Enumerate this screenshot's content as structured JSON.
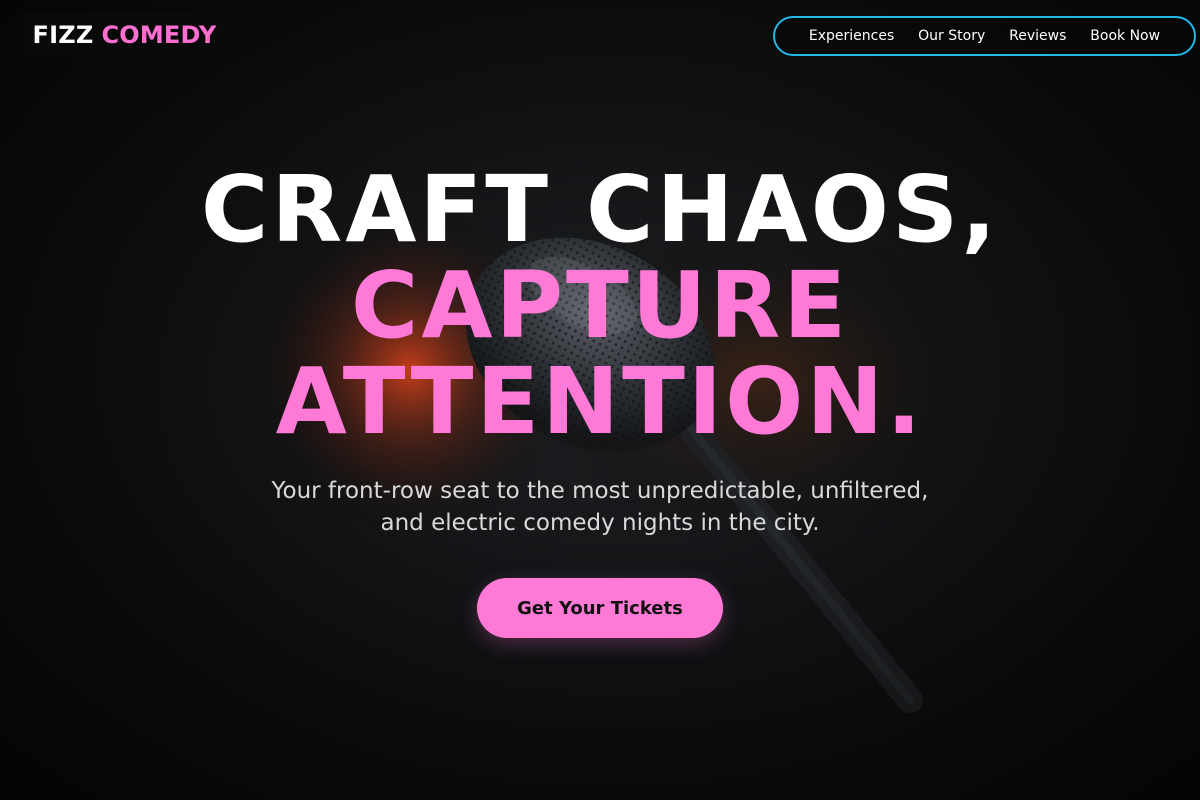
{
  "brand": {
    "name_part1": "FIZZ",
    "name_part2": "COMEDY"
  },
  "nav": {
    "items": [
      {
        "label": "Experiences"
      },
      {
        "label": "Our Story"
      },
      {
        "label": "Reviews"
      },
      {
        "label": "Book Now"
      }
    ]
  },
  "hero": {
    "line1": "CRAFT CHAOS,",
    "line2": "CAPTURE",
    "line3": "ATTENTION.",
    "subtitle": "Your front-row seat to the most unpredictable, unfiltered, and electric comedy nights in the city.",
    "cta_label": "Get Your Tickets"
  },
  "colors": {
    "accent": "#ff7ad6",
    "nav_border": "#22b7e6",
    "background": "#0b0b0c",
    "headline_primary": "#ffffff"
  },
  "icons": {
    "background_image": "microphone-photo"
  }
}
